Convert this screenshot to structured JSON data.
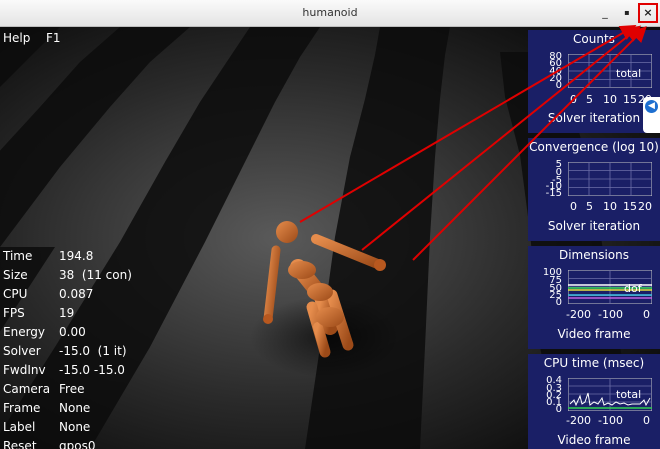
{
  "window": {
    "title": "humanoid",
    "minimize_label": "_",
    "maximize_label": "▪",
    "close_label": "×"
  },
  "menu": {
    "help": "Help",
    "f1": "F1"
  },
  "info": [
    {
      "key": "Time",
      "value": "194.8"
    },
    {
      "key": "Size",
      "value": "38  (11 con)"
    },
    {
      "key": "CPU",
      "value": "0.087"
    },
    {
      "key": "FPS",
      "value": "19"
    },
    {
      "key": "Energy",
      "value": "0.00"
    },
    {
      "key": "Solver",
      "value": "-15.0  (1 it)"
    },
    {
      "key": "FwdInv",
      "value": "-15.0 -15.0"
    },
    {
      "key": "Camera",
      "value": "Free"
    },
    {
      "key": "Frame",
      "value": "None"
    },
    {
      "key": "Label",
      "value": "None"
    },
    {
      "key": "Reset",
      "value": "qpos0"
    }
  ],
  "panels": {
    "counts": {
      "title": "Counts",
      "y_ticks": [
        "80",
        "60",
        "40",
        "20",
        "0"
      ],
      "x_ticks": [
        "0",
        "5",
        "10",
        "15",
        "20"
      ],
      "legend": "total",
      "footer": "Solver iteration"
    },
    "convergence": {
      "title": "Convergence (log 10)",
      "y_ticks": [
        "5",
        "0",
        "-5",
        "-10",
        "-15"
      ],
      "x_ticks": [
        "0",
        "5",
        "10",
        "15",
        "20"
      ],
      "footer": "Solver iteration"
    },
    "dimensions": {
      "title": "Dimensions",
      "y_ticks": [
        "100",
        "75",
        "50",
        "25",
        "0"
      ],
      "x_ticks": [
        "-200",
        "-100",
        "0"
      ],
      "legend": "dof",
      "footer": "Video frame"
    },
    "cpu": {
      "title": "CPU time (msec)",
      "y_ticks": [
        "0.4",
        "0.3",
        "0.2",
        "0.1",
        "0"
      ],
      "x_ticks": [
        "-200",
        "-100",
        "0"
      ],
      "legend": "total",
      "footer": "Video frame"
    }
  },
  "colors": {
    "panel_bg": "#1a1f66",
    "annotation": "#e00000",
    "body": "#c8682a"
  },
  "icons": {
    "side_handle": "arrow-left-icon"
  }
}
